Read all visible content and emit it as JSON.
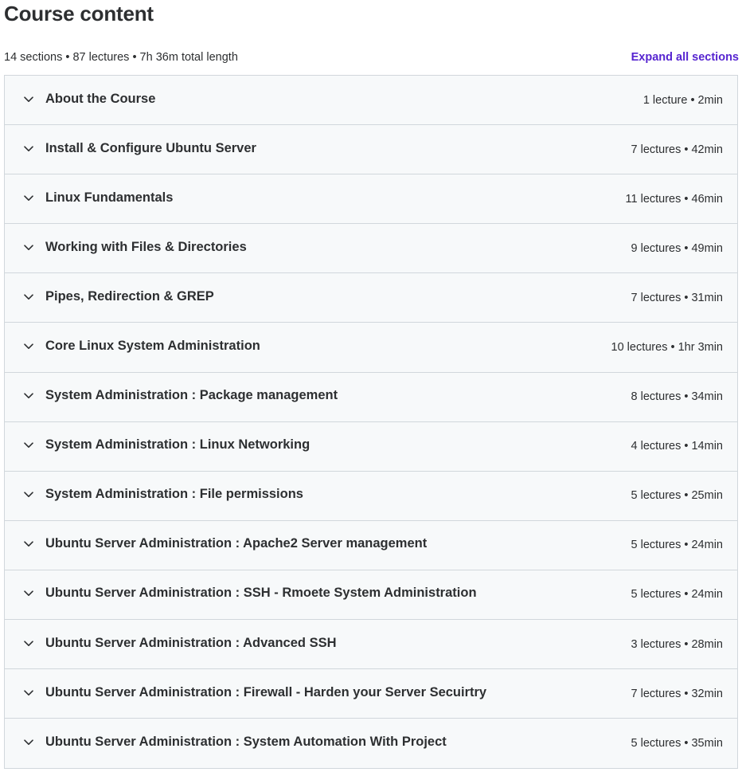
{
  "header": {
    "title": "Course content",
    "summary": "14 sections • 87 lectures • 7h 36m total length",
    "expand_label": "Expand all sections"
  },
  "colors": {
    "accent": "#5624d0",
    "text": "#2d2f31",
    "section_bg": "#f7f9fa",
    "border": "#d1d7dc"
  },
  "sections": [
    {
      "title": "About the Course",
      "meta": "1 lecture • 2min",
      "icon": "chevron-down-icon"
    },
    {
      "title": "Install & Configure Ubuntu Server",
      "meta": "7 lectures • 42min",
      "icon": "chevron-down-icon"
    },
    {
      "title": "Linux Fundamentals",
      "meta": "11 lectures • 46min",
      "icon": "chevron-down-icon"
    },
    {
      "title": "Working with Files & Directories",
      "meta": "9 lectures • 49min",
      "icon": "chevron-down-icon"
    },
    {
      "title": "Pipes, Redirection & GREP",
      "meta": "7 lectures • 31min",
      "icon": "chevron-down-icon"
    },
    {
      "title": "Core Linux System Administration",
      "meta": "10 lectures • 1hr 3min",
      "icon": "chevron-down-icon"
    },
    {
      "title": "System Administration : Package management",
      "meta": "8 lectures • 34min",
      "icon": "chevron-down-icon"
    },
    {
      "title": "System Administration : Linux Networking",
      "meta": "4 lectures • 14min",
      "icon": "chevron-down-icon"
    },
    {
      "title": "System Administration : File permissions",
      "meta": "5 lectures • 25min",
      "icon": "chevron-down-icon"
    },
    {
      "title": "Ubuntu Server Administration : Apache2 Server management",
      "meta": "5 lectures • 24min",
      "icon": "chevron-down-icon"
    },
    {
      "title": "Ubuntu Server Administration : SSH - Rmoete System Administration",
      "meta": "5 lectures • 24min",
      "icon": "chevron-down-icon"
    },
    {
      "title": "Ubuntu Server Administration : Advanced SSH",
      "meta": "3 lectures • 28min",
      "icon": "chevron-down-icon"
    },
    {
      "title": "Ubuntu Server Administration : Firewall - Harden your Server Secuirtry",
      "meta": "7 lectures • 32min",
      "icon": "chevron-down-icon"
    },
    {
      "title": "Ubuntu Server Administration : System Automation With Project",
      "meta": "5 lectures • 35min",
      "icon": "chevron-down-icon"
    }
  ]
}
